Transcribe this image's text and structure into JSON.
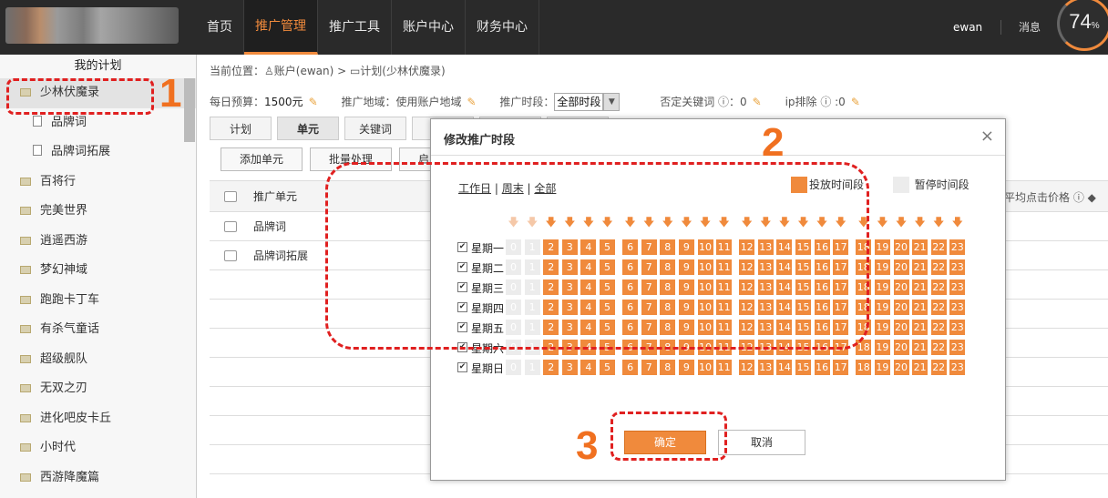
{
  "topbar": {
    "nav": [
      "首页",
      "推广管理",
      "推广工具",
      "账户中心",
      "财务中心"
    ],
    "active_nav": 1,
    "user": "ewan",
    "messages": "消息",
    "meter": "74",
    "meter_unit": "%"
  },
  "sidebar": {
    "title": "我的计划",
    "items": [
      {
        "label": "少林伏魔录",
        "type": "folder",
        "selected": true
      },
      {
        "label": "品牌词",
        "type": "page",
        "sub": true
      },
      {
        "label": "品牌词拓展",
        "type": "page",
        "sub": true
      },
      {
        "label": "百将行",
        "type": "folder"
      },
      {
        "label": "完美世界",
        "type": "folder"
      },
      {
        "label": "逍遥西游",
        "type": "folder"
      },
      {
        "label": "梦幻神域",
        "type": "folder"
      },
      {
        "label": "跑跑卡丁车",
        "type": "folder"
      },
      {
        "label": "有杀气童话",
        "type": "folder"
      },
      {
        "label": "超级舰队",
        "type": "folder"
      },
      {
        "label": "无双之刃",
        "type": "folder"
      },
      {
        "label": "进化吧皮卡丘",
        "type": "folder"
      },
      {
        "label": "小时代",
        "type": "folder"
      },
      {
        "label": "西游降魔篇",
        "type": "folder"
      }
    ]
  },
  "main": {
    "breadcrumb": "当前位置：♙账户(ewan)  > ▭计划(少林伏魔录)",
    "budget_label": "每日预算：",
    "budget_value": "1500元",
    "region": "推广地域：使用账户地域",
    "time_label": "推广时段：",
    "time_value": "全部时段",
    "neg_keywords": "否定关键词 ⓘ：0",
    "ip_exclude": "ip排除 ⓘ :0",
    "tabs": [
      "计划",
      "单元",
      "关键词",
      "",
      "",
      ""
    ],
    "active_tab": 1,
    "buttons": [
      "添加单元",
      "批量处理",
      "启"
    ],
    "grid_header": "推广单元",
    "grid_rows": [
      "品牌词",
      "品牌词拓展"
    ],
    "avg_price": "平均点击价格 ⓘ ◆"
  },
  "modal": {
    "title": "修改推广时段",
    "close": "×",
    "quick_workday": "工作日",
    "quick_weekend": "周末",
    "quick_all": "全部",
    "sep": " | ",
    "legend_on": "投放时间段",
    "legend_off": "暂停时间段",
    "days": [
      "星期一",
      "星期二",
      "星期三",
      "星期四",
      "星期五",
      "星期六",
      "星期日"
    ],
    "hours": [
      "0",
      "1",
      "2",
      "3",
      "4",
      "5",
      "6",
      "7",
      "8",
      "9",
      "10",
      "11",
      "12",
      "13",
      "14",
      "15",
      "16",
      "17",
      "18",
      "19",
      "20",
      "21",
      "22",
      "23"
    ],
    "off_hours": [
      0,
      1
    ],
    "ok": "确定",
    "cancel": "取消",
    "colors": {
      "on": "#f08a3c",
      "off": "#ececec"
    }
  },
  "annotations": [
    "1",
    "2",
    "3"
  ]
}
